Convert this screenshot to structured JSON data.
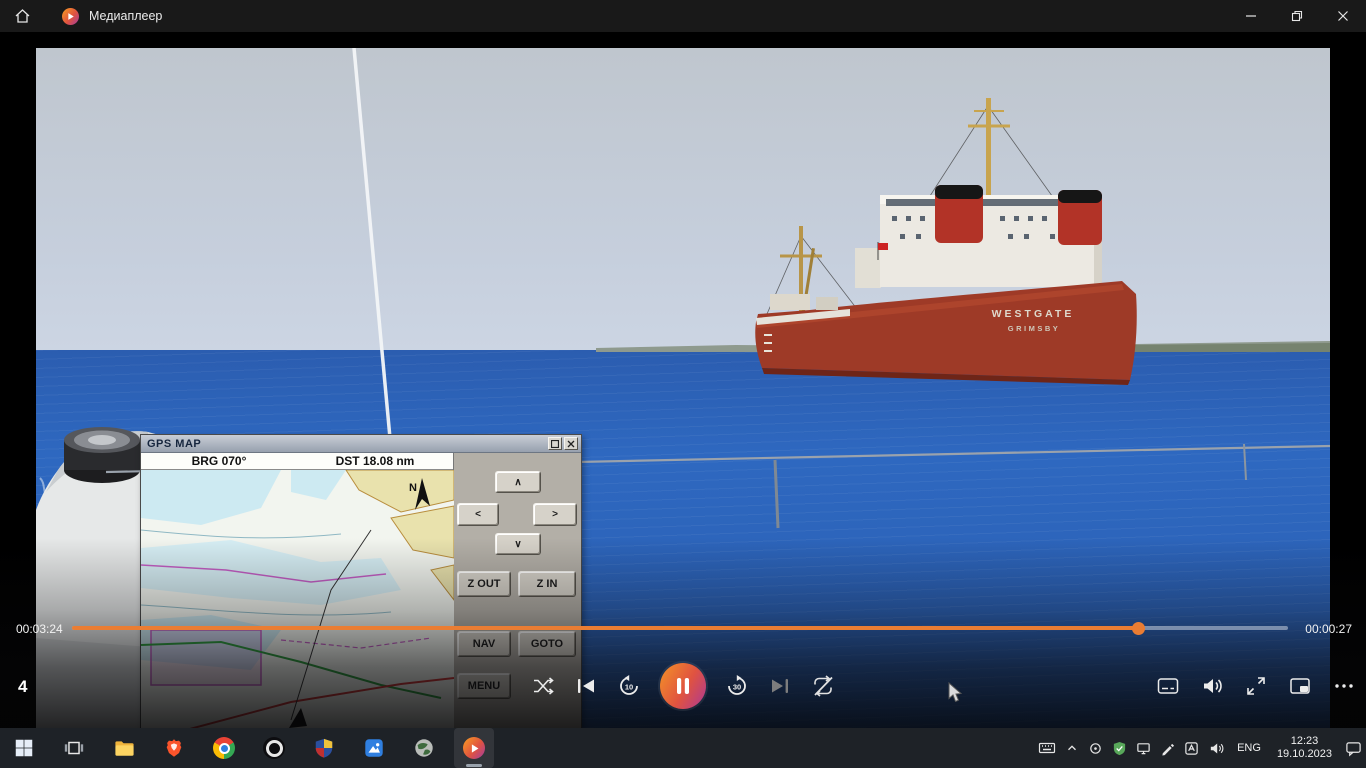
{
  "titlebar": {
    "title": "Медиаплеер"
  },
  "video": {
    "ship": {
      "name": "WESTGATE",
      "port": "GRIMSBY"
    },
    "gps": {
      "title": "GPS MAP",
      "bearing": "BRG 070°",
      "distance": "DST 18.08 nm",
      "north_label": "N",
      "buttons": {
        "up": "∧",
        "left": "<",
        "right": ">",
        "down": "∨",
        "zoom_out": "Z OUT",
        "zoom_in": "Z IN",
        "nav": "NAV",
        "goto": "GOTO",
        "menu": "MENU"
      }
    }
  },
  "player": {
    "overlay_number": "4",
    "elapsed": "00:03:24",
    "remaining": "00:00:27",
    "progress_percent": 87.7,
    "rewind_label": "10",
    "forward_label": "30"
  },
  "taskbar": {
    "tray": {
      "language": "ENG",
      "time": "12:23",
      "date": "19.10.2023"
    }
  },
  "colors": {
    "accent": "#ea7d33",
    "play_gradient_start": "#f28a2a",
    "play_gradient_end": "#b13b8e",
    "sea": "#2e68c0",
    "sky": "#c3c9d3",
    "hull_red": "#9e3a27",
    "taskbar_bg": "#1e2227",
    "titlebar_bg": "#191919"
  }
}
